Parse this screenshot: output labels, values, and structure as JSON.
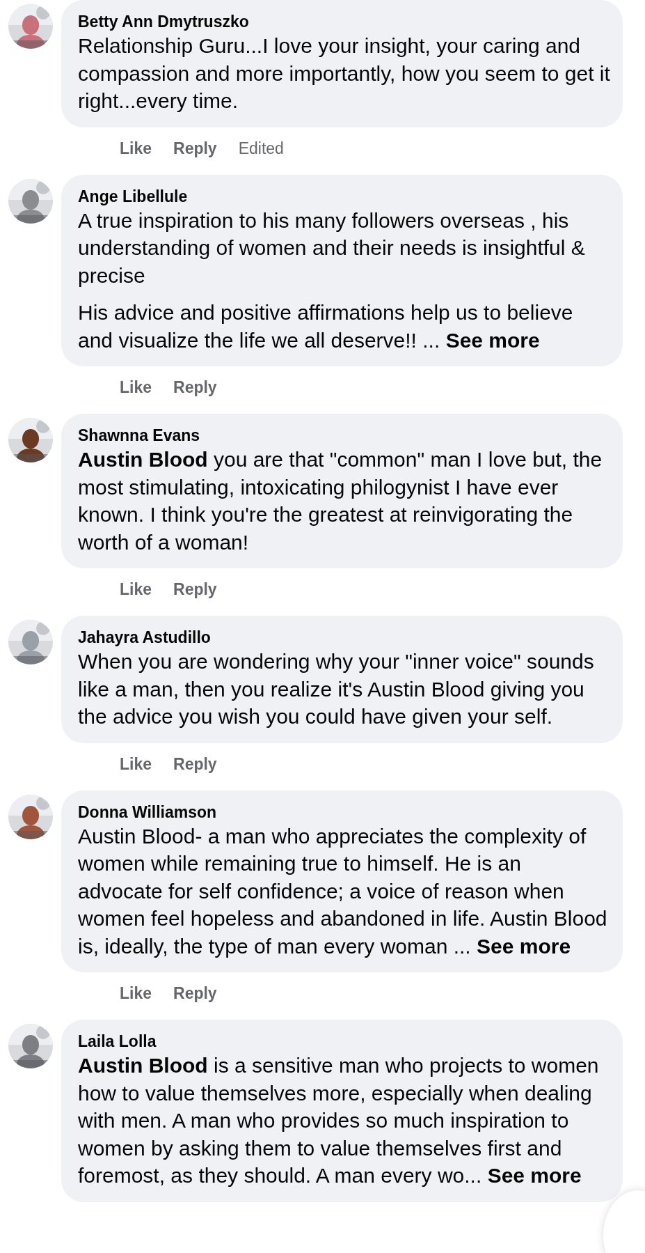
{
  "comments": [
    {
      "author": "Betty Ann Dmytruszko",
      "paragraphs": [
        "Relationship Guru...I love your insight, your caring and compassion and more importantly, how you seem to get it right...every time."
      ],
      "actions": [
        {
          "label": "Like",
          "kind": "link"
        },
        {
          "label": "Reply",
          "kind": "link"
        },
        {
          "label": "Edited",
          "kind": "note"
        }
      ]
    },
    {
      "author": "Ange Libellule",
      "paragraphs": [
        "A true inspiration to his many followers overseas , his understanding of women and their needs is insightful & precise",
        "His advice and positive affirmations help us to believe and visualize the life we all deserve!! ..."
      ],
      "see_more": "See more",
      "actions": [
        {
          "label": "Like",
          "kind": "link"
        },
        {
          "label": "Reply",
          "kind": "link"
        }
      ]
    },
    {
      "author": "Shawnna Evans",
      "paragraphs": [
        "**Austin Blood** you are that \"common\" man I love but, the most stimulating, intoxicating philogynist I have ever known. I think you're the greatest at reinvigorating the worth of a woman!"
      ],
      "actions": [
        {
          "label": "Like",
          "kind": "link"
        },
        {
          "label": "Reply",
          "kind": "link"
        }
      ]
    },
    {
      "author": "Jahayra Astudillo",
      "paragraphs": [
        "When you are wondering why your \"inner voice\" sounds like a man, then you realize it's Austin Blood giving you the advice you wish you could have given your self."
      ],
      "actions": [
        {
          "label": "Like",
          "kind": "link"
        },
        {
          "label": "Reply",
          "kind": "link"
        }
      ]
    },
    {
      "author": "Donna Williamson",
      "paragraphs": [
        "Austin Blood- a man who appreciates the complexity of women while remaining true to himself. He is an advocate for self confidence; a voice of reason when women feel hopeless and abandoned in life. Austin Blood is, ideally, the type of man every woman ..."
      ],
      "see_more": "See more",
      "actions": [
        {
          "label": "Like",
          "kind": "link"
        },
        {
          "label": "Reply",
          "kind": "link"
        }
      ]
    },
    {
      "author": "Laila Lolla",
      "paragraphs": [
        "**Austin Blood** is a sensitive man who projects to women how to value themselves more, especially when dealing with men. A man who provides so much inspiration to women by asking them to value themselves first and foremost, as they should. A man every wo..."
      ],
      "see_more": "See more"
    }
  ]
}
